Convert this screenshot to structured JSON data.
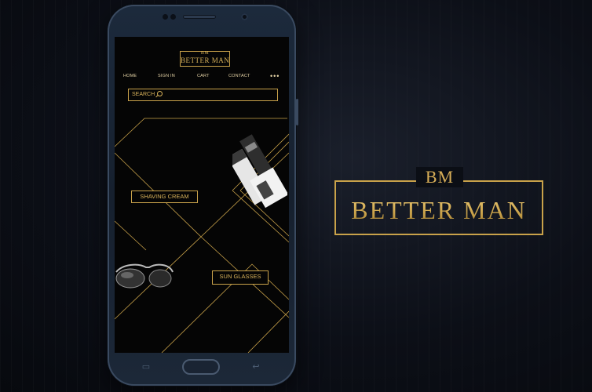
{
  "app": {
    "logo_monogram": "BM",
    "logo_name": "BETTER MAN",
    "nav": {
      "home": "HOME",
      "sign_in": "SIGN IN",
      "cart": "CART",
      "contact": "CONTACT",
      "more": "•••"
    },
    "search": {
      "placeholder": "SEARCH"
    },
    "categories": {
      "shaving_cream": "SHAVING CREAM",
      "sun_glasses": "SUN GLASSES"
    }
  },
  "brand": {
    "monogram": "BM",
    "name": "BETTER MAN"
  },
  "colors": {
    "gold": "#c9a24a",
    "screen_bg": "#050505",
    "page_bg": "#0c0f17",
    "phone_body": "#1c2a3c"
  },
  "icons": {
    "search": "magnifier-icon",
    "more": "more-dots-icon",
    "recent_apps": "recent-apps-icon",
    "back": "back-arrow-icon"
  }
}
